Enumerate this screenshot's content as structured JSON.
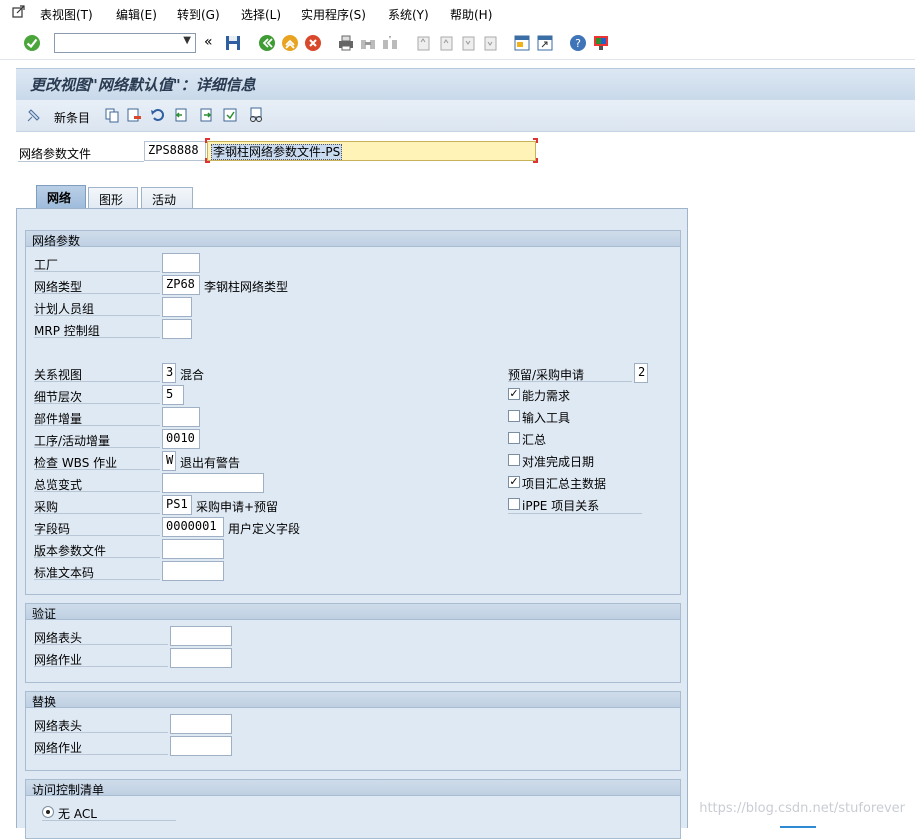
{
  "menu": [
    "表视图(T)",
    "编辑(E)",
    "转到(G)",
    "选择(L)",
    "实用程序(S)",
    "系统(Y)",
    "帮助(H)"
  ],
  "toolbar": {
    "command_value": "",
    "collapse": "«"
  },
  "title": "更改视图\"网络默认值\"：详细信息",
  "app_toolbar": {
    "new_entries": "新条目"
  },
  "header_field": {
    "label": "网络参数文件",
    "code": "ZPS8888",
    "desc": "李钢柱网络参数文件-PS"
  },
  "tabs": [
    "网络",
    "图形",
    "活动"
  ],
  "groups": {
    "network_params": {
      "title": "网络参数",
      "plant": {
        "label": "工厂",
        "value": ""
      },
      "network_type": {
        "label": "网络类型",
        "value": "ZP68",
        "desc": "李钢柱网络类型"
      },
      "planner_group": {
        "label": "计划人员组",
        "value": ""
      },
      "mrp_group": {
        "label": "MRP 控制组",
        "value": ""
      },
      "relationship_view": {
        "label": "关系视图",
        "value": "3",
        "desc": "混合"
      },
      "level_of_detail": {
        "label": "细节层次",
        "value": "5"
      },
      "part_increment": {
        "label": "部件增量",
        "value": ""
      },
      "operation_increment": {
        "label": "工序/活动增量",
        "value": "0010"
      },
      "check_wbs": {
        "label": "检查 WBS 作业",
        "value": "W",
        "desc": "退出有警告"
      },
      "overview_variant": {
        "label": "总览变式",
        "value": ""
      },
      "purchasing": {
        "label": "采购",
        "value": "PS1",
        "desc": "采购申请+预留"
      },
      "field_key": {
        "label": "字段码",
        "value": "0000001",
        "desc": "用户定义字段"
      },
      "version_profile": {
        "label": "版本参数文件",
        "value": ""
      },
      "std_text_key": {
        "label": "标准文本码",
        "value": ""
      },
      "reservation": {
        "label": "预留/采购申请",
        "value": "2"
      },
      "checkboxes": [
        {
          "label": "能力需求",
          "checked": true
        },
        {
          "label": "输入工具",
          "checked": false
        },
        {
          "label": "汇总",
          "checked": false
        },
        {
          "label": "对准完成日期",
          "checked": false
        },
        {
          "label": "项目汇总主数据",
          "checked": true
        },
        {
          "label": "iPPE 项目关系",
          "checked": false
        }
      ]
    },
    "validation": {
      "title": "验证",
      "header": {
        "label": "网络表头",
        "value": ""
      },
      "activity": {
        "label": "网络作业",
        "value": ""
      }
    },
    "substitution": {
      "title": "替换",
      "header": {
        "label": "网络表头",
        "value": ""
      },
      "activity": {
        "label": "网络作业",
        "value": ""
      }
    },
    "acl": {
      "title": "访问控制清单",
      "option": {
        "label": "无 ACL",
        "selected": true
      }
    }
  },
  "watermark": "https://blog.csdn.net/stuforever",
  "colors": {
    "panel_bg": "#dfe9f3",
    "title_text": "#2a3b52",
    "highlight_field": "#fff3b8"
  }
}
